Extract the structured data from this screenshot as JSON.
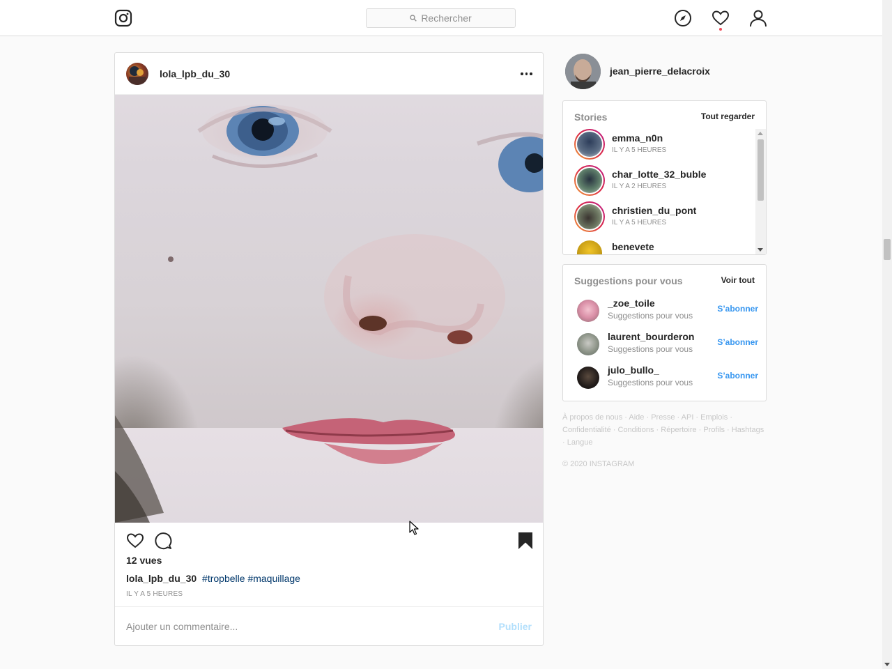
{
  "nav": {
    "search_placeholder": "Rechercher",
    "icons": [
      "instagram-logo-icon",
      "compass-icon",
      "heart-icon",
      "profile-icon"
    ],
    "notification_dot_color": "#ed4956"
  },
  "post": {
    "username": "lola_lpb_du_30",
    "views": "12 vues",
    "caption_user": "lola_lpb_du_30",
    "hashtags": [
      "#tropbelle",
      "#maquillage"
    ],
    "timestamp": "IL Y A 5 HEURES",
    "comment_placeholder": "Ajouter un commentaire...",
    "publish_label": "Publier"
  },
  "sidebar": {
    "me": {
      "username": "jean_pierre_delacroix"
    },
    "stories": {
      "title": "Stories",
      "link": "Tout regarder",
      "items": [
        {
          "name": "emma_n0n",
          "time": "IL Y A 5 HEURES"
        },
        {
          "name": "char_lotte_32_buble",
          "time": "IL Y A 2 HEURES"
        },
        {
          "name": "christien_du_pont",
          "time": "IL Y A 5 HEURES"
        },
        {
          "name": "benevete",
          "time": ""
        }
      ]
    },
    "suggestions": {
      "title": "Suggestions pour vous",
      "link": "Voir tout",
      "items": [
        {
          "name": "_zoe_toile",
          "sub": "Suggestions pour vous",
          "action": "S’abonner"
        },
        {
          "name": "laurent_bourderon",
          "sub": "Suggestions pour vous",
          "action": "S’abonner"
        },
        {
          "name": "julo_bullo_",
          "sub": "Suggestions pour vous",
          "action": "S’abonner"
        }
      ]
    },
    "footer": {
      "links": [
        "À propos de nous",
        "Aide",
        "Presse",
        "API",
        "Emplois",
        "Confidentialité",
        "Conditions",
        "Répertoire",
        "Profils",
        "Hashtags",
        "Langue"
      ],
      "copyright": "© 2020 INSTAGRAM"
    }
  },
  "colors": {
    "link": "#3897f0",
    "hashtag": "#00376b",
    "muted": "#8e8e8e"
  }
}
